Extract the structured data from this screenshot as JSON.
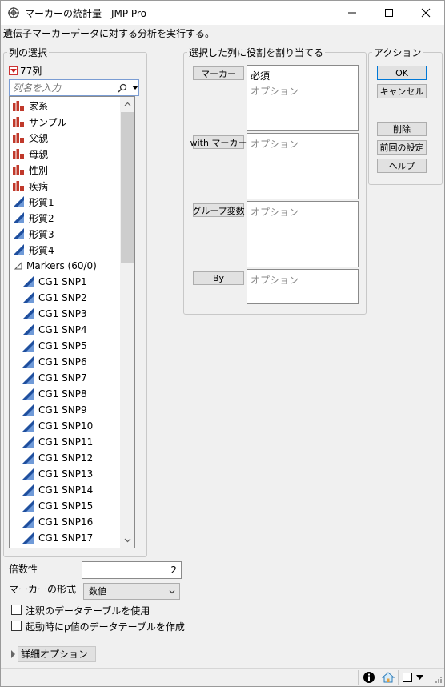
{
  "window": {
    "title": "マーカーの統計量 - JMP Pro",
    "description": "遺伝子マーカーデータに対する分析を実行する。"
  },
  "column_select": {
    "group_label": "列の選択",
    "count": "77列",
    "search_placeholder": "列名を入力",
    "items": [
      {
        "label": "家系",
        "icon": "nominal-bar-icon"
      },
      {
        "label": "サンプル",
        "icon": "nominal-bar-icon"
      },
      {
        "label": "父親",
        "icon": "nominal-bar-icon"
      },
      {
        "label": "母親",
        "icon": "nominal-bar-icon"
      },
      {
        "label": "性別",
        "icon": "nominal-bar-icon"
      },
      {
        "label": "疾病",
        "icon": "nominal-bar-icon"
      },
      {
        "label": "形質1",
        "icon": "continuous-triangle-icon"
      },
      {
        "label": "形質2",
        "icon": "continuous-triangle-icon"
      },
      {
        "label": "形質3",
        "icon": "continuous-triangle-icon"
      },
      {
        "label": "形質4",
        "icon": "continuous-triangle-icon"
      }
    ],
    "group_header": "Markers (60/0)",
    "markers": [
      "CG1 SNP1",
      "CG1 SNP2",
      "CG1 SNP3",
      "CG1 SNP4",
      "CG1 SNP5",
      "CG1 SNP6",
      "CG1 SNP7",
      "CG1 SNP8",
      "CG1 SNP9",
      "CG1 SNP10",
      "CG1 SNP11",
      "CG1 SNP12",
      "CG1 SNP13",
      "CG1 SNP14",
      "CG1 SNP15",
      "CG1 SNP16",
      "CG1 SNP17"
    ]
  },
  "roles": {
    "group_label": "選択した列に役割を割り当てる",
    "items": [
      {
        "button": "マーカー",
        "required": "必須",
        "optional": "オプション"
      },
      {
        "button": "with マーカー",
        "optional": "オプション"
      },
      {
        "button": "グループ変数",
        "optional": "オプション"
      },
      {
        "button": "By",
        "optional": "オプション"
      }
    ]
  },
  "actions": {
    "group_label": "アクション",
    "ok": "OK",
    "cancel": "キャンセル",
    "remove": "削除",
    "recall": "前回の設定",
    "help": "ヘルプ"
  },
  "options": {
    "ploidy_label": "倍数性",
    "ploidy_value": "2",
    "format_label": "マーカーの形式",
    "format_value": "数値",
    "checkbox_annot": "注釈のデータテーブルを使用",
    "checkbox_pvalue": "起動時にp値のデータテーブルを作成",
    "advanced": "詳細オプション"
  },
  "colors": {
    "nominal": "#c0392b",
    "continuous": "#1f4f9e",
    "accent": "#0078d7"
  }
}
